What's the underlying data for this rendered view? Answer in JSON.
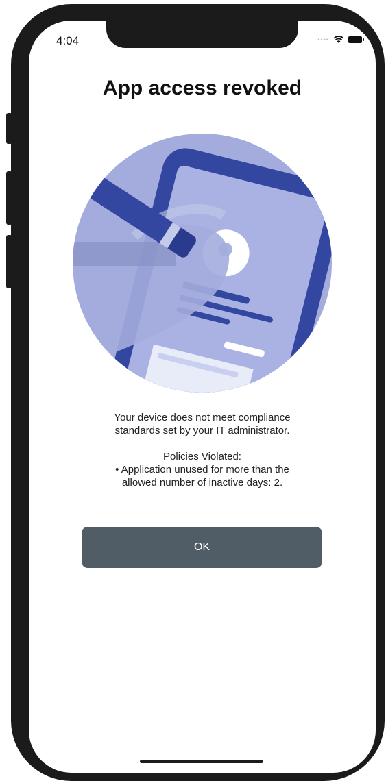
{
  "status_bar": {
    "time": "4:04",
    "signal_icon": "cellular-dots-icon",
    "wifi_icon": "wifi-icon",
    "battery_icon": "battery-icon"
  },
  "dialog": {
    "title": "App access revoked",
    "illustration_icon": "wiped-tablet-illustration",
    "message_line1": "Your device does not meet compliance",
    "message_line2": "standards set by your IT administrator.",
    "policies_header": "Policies Violated:",
    "policy_line1": "• Application unused for more than the",
    "policy_line2": "allowed number of inactive days: 2.",
    "ok_label": "OK"
  },
  "colors": {
    "illustration_light": "#a3acdd",
    "illustration_dark": "#3346a0",
    "button_bg": "#505c66",
    "button_text": "#ffffff"
  }
}
